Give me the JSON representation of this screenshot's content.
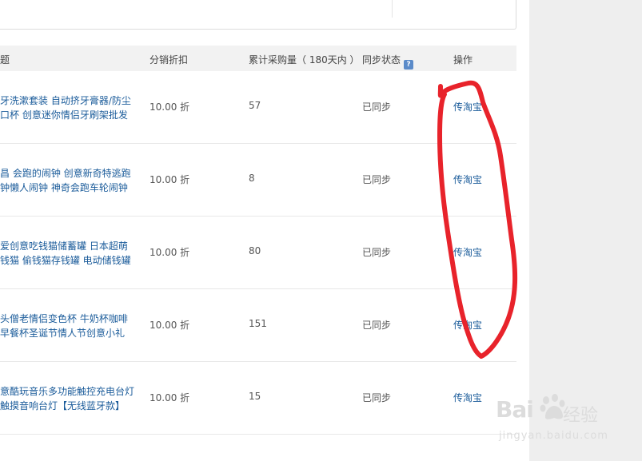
{
  "header": {
    "col_title": "题",
    "col_discount": "分销折扣",
    "col_qty": "累计采购量（ 180天内 ）",
    "col_sync": "同步状态",
    "col_action": "操作",
    "help_glyph": "?"
  },
  "rows": [
    {
      "title1": "牙洗漱套装 自动挤牙膏器/防尘",
      "title2": "口杯 创意迷你情侣牙刷架批发",
      "discount": "10.00 折",
      "qty": "57",
      "sync": "已同步",
      "action": "传淘宝"
    },
    {
      "title1": "昌 会跑的闹钟 创意新奇特逃跑",
      "title2": "钟懒人闹钟 神奇会跑车轮闹钟",
      "discount": "10.00 折",
      "qty": "8",
      "sync": "已同步",
      "action": "传淘宝"
    },
    {
      "title1": "爱创意吃钱猫储蓄罐 日本超萌",
      "title2": "钱猫 偷钱猫存钱罐 电动储钱罐",
      "discount": "10.00 折",
      "qty": "80",
      "sync": "已同步",
      "action": "传淘宝"
    },
    {
      "title1": "头僧老情侣变色杯 牛奶杯咖啡",
      "title2": " 早餐杯圣诞节情人节创意小礼",
      "discount": "10.00 折",
      "qty": "151",
      "sync": "已同步",
      "action": "传淘宝"
    },
    {
      "title1": "意酷玩音乐多功能触控充电台灯",
      "title2": "触摸音响台灯【无线蓝牙款】",
      "discount": "10.00 折",
      "qty": "15",
      "sync": "已同步",
      "action": "传淘宝"
    }
  ],
  "watermark": {
    "brand": "Bai",
    "brand2": "经验",
    "url": "jingyan.baidu.com"
  },
  "colors": {
    "link": "#1a5b9a",
    "annotation": "#e8232b",
    "header_bg": "#f2f2f2"
  }
}
